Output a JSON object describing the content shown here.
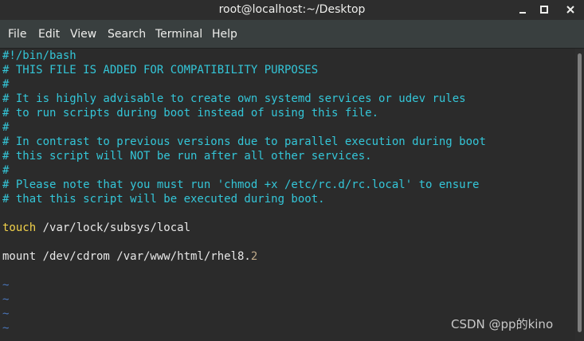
{
  "window": {
    "title": "root@localhost:~/Desktop",
    "buttons": {
      "minimize_icon": "minimize-icon",
      "maximize_icon": "maximize-icon",
      "close_icon": "close-icon"
    }
  },
  "menubar": {
    "items": [
      "File",
      "Edit",
      "View",
      "Search",
      "Terminal",
      "Help"
    ]
  },
  "editor": {
    "lines": [
      {
        "kind": "comment",
        "text": "#!/bin/bash"
      },
      {
        "kind": "comment",
        "text": "# THIS FILE IS ADDED FOR COMPATIBILITY PURPOSES"
      },
      {
        "kind": "comment",
        "text": "#"
      },
      {
        "kind": "comment",
        "text": "# It is highly advisable to create own systemd services or udev rules"
      },
      {
        "kind": "comment",
        "text": "# to run scripts during boot instead of using this file."
      },
      {
        "kind": "comment",
        "text": "#"
      },
      {
        "kind": "comment",
        "text": "# In contrast to previous versions due to parallel execution during boot"
      },
      {
        "kind": "comment",
        "text": "# this script will NOT be run after all other services."
      },
      {
        "kind": "comment",
        "text": "#"
      },
      {
        "kind": "comment",
        "text": "# Please note that you must run 'chmod +x /etc/rc.d/rc.local' to ensure"
      },
      {
        "kind": "comment",
        "text": "# that this script will be executed during boot."
      },
      {
        "kind": "blank",
        "text": ""
      },
      {
        "kind": "command",
        "keyword": "touch",
        "rest": " /var/lock/subsys/local"
      },
      {
        "kind": "blank",
        "text": ""
      },
      {
        "kind": "mixed",
        "plain": "mount /dev/cdrom /var/www/html/rhel8.",
        "number": "2"
      },
      {
        "kind": "blank",
        "text": ""
      },
      {
        "kind": "tilde",
        "text": "~"
      },
      {
        "kind": "tilde",
        "text": "~"
      },
      {
        "kind": "tilde",
        "text": "~"
      },
      {
        "kind": "tilde",
        "text": "~"
      }
    ]
  },
  "watermark": "CSDN @pp的kino",
  "colors": {
    "comment": "#34c6d8",
    "keyword": "#f2d24a",
    "plain": "#e8e8e8",
    "number": "#c0aa8a",
    "tilde": "#4a76ba",
    "background": "#2b2b2b",
    "menubar": "#393f3f",
    "titlebar": "#2d2d2d"
  }
}
